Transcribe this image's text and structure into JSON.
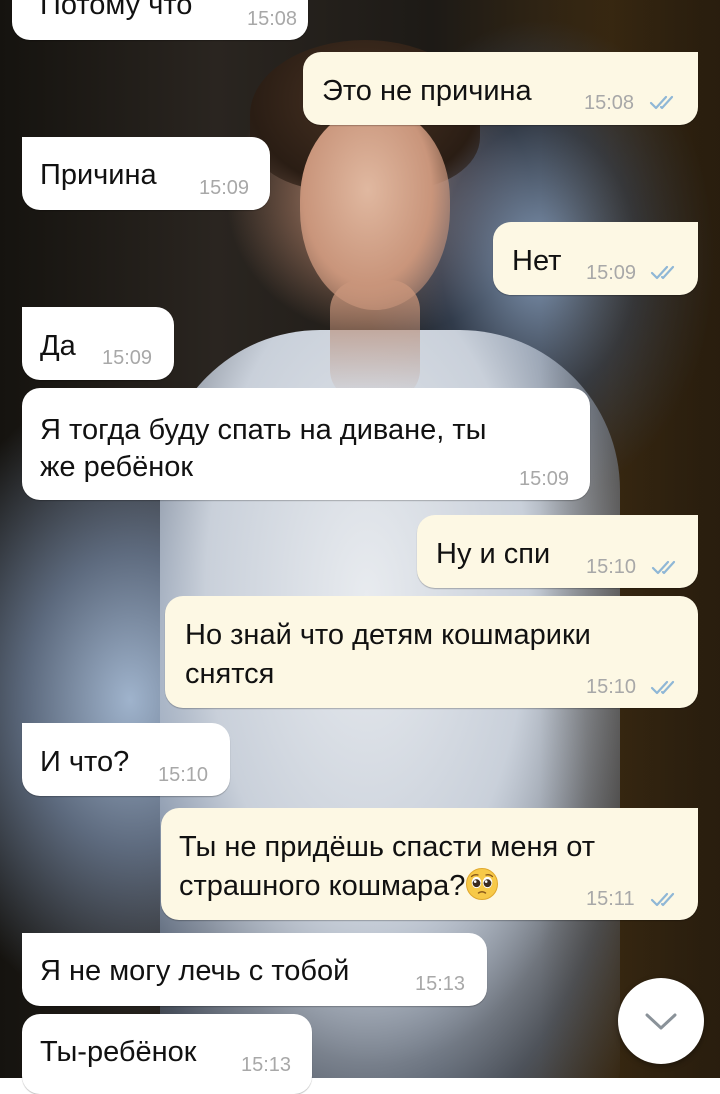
{
  "messages": [
    {
      "direction": "in",
      "text": "Потому что",
      "time": "15:08"
    },
    {
      "direction": "out",
      "text": "Это не причина",
      "time": "15:08",
      "status": "read"
    },
    {
      "direction": "in",
      "text": "Причина",
      "time": "15:09"
    },
    {
      "direction": "out",
      "text": "Нет",
      "time": "15:09",
      "status": "read"
    },
    {
      "direction": "in",
      "text": "Да",
      "time": "15:09"
    },
    {
      "direction": "in",
      "lines": [
        "Я тогда буду спать на диване, ты",
        "же ребёнок"
      ],
      "time": "15:09"
    },
    {
      "direction": "out",
      "text": "Ну и спи",
      "time": "15:10",
      "status": "read"
    },
    {
      "direction": "out",
      "lines": [
        "Но знай что детям кошмарики",
        "снятся"
      ],
      "time": "15:10",
      "status": "read"
    },
    {
      "direction": "in",
      "text": "И что?",
      "time": "15:10"
    },
    {
      "direction": "out",
      "lines": [
        "Ты не придёшь спасти меня от",
        "страшного кошмара?"
      ],
      "emoji": "pleading-face",
      "time": "15:11",
      "status": "read"
    },
    {
      "direction": "in",
      "text": "Я не могу лечь с тобой",
      "time": "15:13"
    },
    {
      "direction": "in",
      "text": "Ты-ребёнок",
      "time": "15:13"
    }
  ],
  "colors": {
    "incoming_bubble": "#ffffff",
    "outgoing_bubble": "#fdf8e4",
    "read_ticks": "#8fb7d6",
    "time_text": "#a8a8a8"
  },
  "scroll_button": {
    "icon": "chevron-down-icon"
  }
}
